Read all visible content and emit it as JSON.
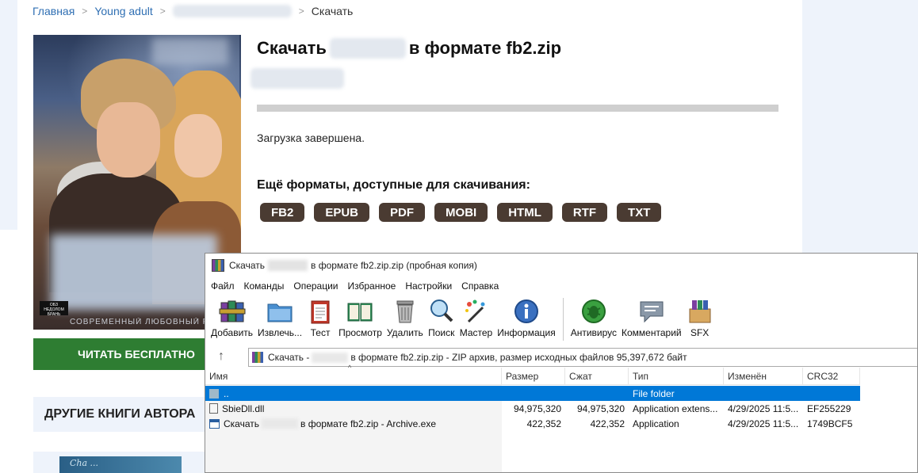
{
  "page": {
    "breadcrumb": {
      "home": "Главная",
      "genre": "Young adult",
      "current": "Скачать"
    },
    "cover": {
      "series_text": "СОВРЕМЕННЫЙ ЛЮБОВНЫЙ Р",
      "logo_text": "ОБЗ НЕДОЛОМ БРАНЬ"
    },
    "read_button": "ЧИТАТЬ БЕСПЛАТНО",
    "other_books": "ДРУГИЕ КНИГИ АВТОРА",
    "thumb_text": "Cha ...",
    "title_prefix": "Скачать",
    "title_suffix": "в формате fb2.zip",
    "progress_fraction": 1.0,
    "status": "Загрузка завершена.",
    "more_formats_heading": "Ещё форматы, доступные для скачивания:",
    "formats": [
      "FB2",
      "EPUB",
      "PDF",
      "MOBI",
      "HTML",
      "RTF",
      "TXT"
    ]
  },
  "winrar": {
    "title_prefix": "Скачать",
    "title_suffix": "в формате fb2.zip.zip (пробная копия)",
    "menu": [
      "Файл",
      "Команды",
      "Операции",
      "Избранное",
      "Настройки",
      "Справка"
    ],
    "toolbar": [
      {
        "label": "Добавить",
        "icon": "add-books-icon"
      },
      {
        "label": "Извлечь...",
        "icon": "extract-folder-icon"
      },
      {
        "label": "Тест",
        "icon": "test-clipboard-icon"
      },
      {
        "label": "Просмотр",
        "icon": "view-book-icon"
      },
      {
        "label": "Удалить",
        "icon": "delete-trash-icon"
      },
      {
        "label": "Поиск",
        "icon": "find-magnifier-icon"
      },
      {
        "label": "Мастер",
        "icon": "wizard-wand-icon"
      },
      {
        "label": "Информация",
        "icon": "info-icon"
      },
      {
        "label": "Антивирус",
        "icon": "antivirus-bug-icon"
      },
      {
        "label": "Комментарий",
        "icon": "comment-icon"
      },
      {
        "label": "SFX",
        "icon": "sfx-box-icon"
      }
    ],
    "path_prefix": "Скачать -",
    "path_suffix": "в формате fb2.zip.zip - ZIP архив, размер исходных файлов 95,397,672 байт",
    "columns": [
      "Имя",
      "Размер",
      "Сжат",
      "Тип",
      "Изменён",
      "CRC32"
    ],
    "rows": [
      {
        "name": "..",
        "size": "",
        "packed": "",
        "type": "File folder",
        "modified": "",
        "crc": ""
      },
      {
        "name": "SbieDll.dll",
        "size": "94,975,320",
        "packed": "94,975,320",
        "type": "Application extens...",
        "modified": "4/29/2025 11:5...",
        "crc": "EF255229"
      },
      {
        "name_prefix": "Скачать",
        "name_suffix": "в формате fb2.zip - Archive.exe",
        "size": "422,352",
        "packed": "422,352",
        "type": "Application",
        "modified": "4/29/2025 11:5...",
        "crc": "1749BCF5"
      }
    ]
  },
  "colors": {
    "accent_blue": "#0078d7",
    "read_button_green": "#2e7d32",
    "format_chip": "#4a3b32",
    "link": "#2f6fb3"
  }
}
